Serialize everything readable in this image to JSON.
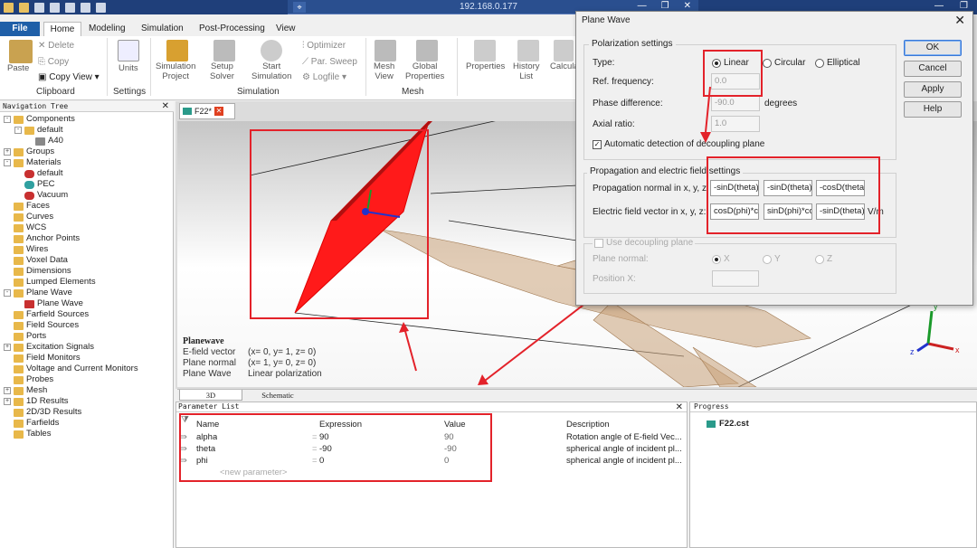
{
  "window": {
    "remote_title": "192.168.0.177"
  },
  "ribbon": {
    "file_tab": "File",
    "tabs": [
      "Home",
      "Modeling",
      "Simulation",
      "Post-Processing",
      "View"
    ],
    "clipboard": {
      "paste": "Paste",
      "delete": "Delete",
      "copy": "Copy",
      "copy_view": "Copy View",
      "group": "Clipboard"
    },
    "settings": {
      "units": "Units",
      "group": "Settings"
    },
    "simulation": {
      "project": "Simulation\nProject",
      "setup": "Setup\nSolver",
      "start": "Start\nSimulation",
      "optimizer": "Optimizer",
      "par_sweep": "Par. Sweep",
      "logfile": "Logfile",
      "group": "Simulation"
    },
    "mesh": {
      "mesh_view": "Mesh\nView",
      "global": "Global\nProperties",
      "group": "Mesh"
    },
    "extra": {
      "properties": "Properties",
      "history": "History\nList",
      "calc": "Calcula"
    }
  },
  "nav": {
    "title": "Navigation Tree",
    "items": [
      {
        "label": "Components",
        "level": 0,
        "exp": "-",
        "icon": "folder"
      },
      {
        "label": "default",
        "level": 1,
        "exp": "-",
        "icon": "folder"
      },
      {
        "label": "A40",
        "level": 2,
        "exp": "",
        "icon": "solid"
      },
      {
        "label": "Groups",
        "level": 0,
        "exp": "+",
        "icon": "folder"
      },
      {
        "label": "Materials",
        "level": 0,
        "exp": "-",
        "icon": "folder"
      },
      {
        "label": "default",
        "level": 1,
        "exp": "",
        "icon": "mat-red"
      },
      {
        "label": "PEC",
        "level": 1,
        "exp": "",
        "icon": "mat-teal"
      },
      {
        "label": "Vacuum",
        "level": 1,
        "exp": "",
        "icon": "mat-red"
      },
      {
        "label": "Faces",
        "level": 0,
        "exp": "",
        "icon": "folder"
      },
      {
        "label": "Curves",
        "level": 0,
        "exp": "",
        "icon": "folder"
      },
      {
        "label": "WCS",
        "level": 0,
        "exp": "",
        "icon": "folder"
      },
      {
        "label": "Anchor Points",
        "level": 0,
        "exp": "",
        "icon": "folder"
      },
      {
        "label": "Wires",
        "level": 0,
        "exp": "",
        "icon": "folder"
      },
      {
        "label": "Voxel Data",
        "level": 0,
        "exp": "",
        "icon": "folder"
      },
      {
        "label": "Dimensions",
        "level": 0,
        "exp": "",
        "icon": "folder"
      },
      {
        "label": "Lumped Elements",
        "level": 0,
        "exp": "",
        "icon": "folder"
      },
      {
        "label": "Plane Wave",
        "level": 0,
        "exp": "-",
        "icon": "folder"
      },
      {
        "label": "Plane Wave",
        "level": 1,
        "exp": "",
        "icon": "planewave"
      },
      {
        "label": "Farfield Sources",
        "level": 0,
        "exp": "",
        "icon": "folder"
      },
      {
        "label": "Field Sources",
        "level": 0,
        "exp": "",
        "icon": "folder"
      },
      {
        "label": "Ports",
        "level": 0,
        "exp": "",
        "icon": "folder"
      },
      {
        "label": "Excitation Signals",
        "level": 0,
        "exp": "+",
        "icon": "folder"
      },
      {
        "label": "Field Monitors",
        "level": 0,
        "exp": "",
        "icon": "folder"
      },
      {
        "label": "Voltage and Current Monitors",
        "level": 0,
        "exp": "",
        "icon": "folder"
      },
      {
        "label": "Probes",
        "level": 0,
        "exp": "",
        "icon": "folder"
      },
      {
        "label": "Mesh",
        "level": 0,
        "exp": "+",
        "icon": "folder"
      },
      {
        "label": "1D Results",
        "level": 0,
        "exp": "+",
        "icon": "folder"
      },
      {
        "label": "2D/3D Results",
        "level": 0,
        "exp": "",
        "icon": "folder"
      },
      {
        "label": "Farfields",
        "level": 0,
        "exp": "",
        "icon": "folder"
      },
      {
        "label": "Tables",
        "level": 0,
        "exp": "",
        "icon": "folder"
      }
    ]
  },
  "doc": {
    "tab": "F22*"
  },
  "viewport_info": {
    "title": "Planewave",
    "rows": [
      {
        "k": "E-field vector",
        "v": "(x= 0, y= 1, z= 0)"
      },
      {
        "k": "Plane normal",
        "v": "(x= 1, y= 0, z= 0)"
      },
      {
        "k": "Plane Wave",
        "v": "Linear polarization"
      }
    ]
  },
  "view_tabs": [
    "3D",
    "Schematic"
  ],
  "params": {
    "title": "Parameter List",
    "headers": [
      "Name",
      "Expression",
      "Value",
      "Description"
    ],
    "rows": [
      {
        "name": "alpha",
        "expr": "90",
        "value": "90",
        "desc": "Rotation angle of E-field Vec..."
      },
      {
        "name": "theta",
        "expr": "-90",
        "value": "-90",
        "desc": "spherical angle of incident pl..."
      },
      {
        "name": "phi",
        "expr": "0",
        "value": "0",
        "desc": "spherical angle of incident pl..."
      }
    ],
    "new_param": "<new parameter>"
  },
  "progress": {
    "title": "Progress",
    "item": "F22.cst"
  },
  "dialog": {
    "title": "Plane Wave",
    "pol_group": "Polarization settings",
    "type_label": "Type:",
    "radios": [
      "Linear",
      "Circular",
      "Elliptical"
    ],
    "ref_freq_label": "Ref. frequency:",
    "ref_freq": "0.0",
    "phase_label": "Phase difference:",
    "phase": "-90.0",
    "phase_unit": "degrees",
    "axial_label": "Axial ratio:",
    "axial": "1.0",
    "auto_detect": "Automatic detection of decoupling plane",
    "prop_group": "Propagation and electric field settings",
    "prop_label": "Propagation normal in x, y, z:",
    "prop": [
      "-sinD(theta)",
      "-sinD(theta)",
      "-cosD(theta)"
    ],
    "ef_label": "Electric field vector in x, y, z:",
    "ef": [
      "cosD(phi)*c",
      "sinD(phi)*co",
      "-sinD(theta)"
    ],
    "ef_unit": "V/m",
    "use_decoupling": "Use decoupling plane",
    "plane_normal": "Plane normal:",
    "plane_radios": [
      "X",
      "Y",
      "Z"
    ],
    "position_x": "Position X:",
    "buttons": [
      "OK",
      "Cancel",
      "Apply",
      "Help"
    ]
  },
  "colors": {
    "highlight": "#e3222a",
    "accent": "#1f5fa8",
    "planewave": "#ff1a1a"
  }
}
